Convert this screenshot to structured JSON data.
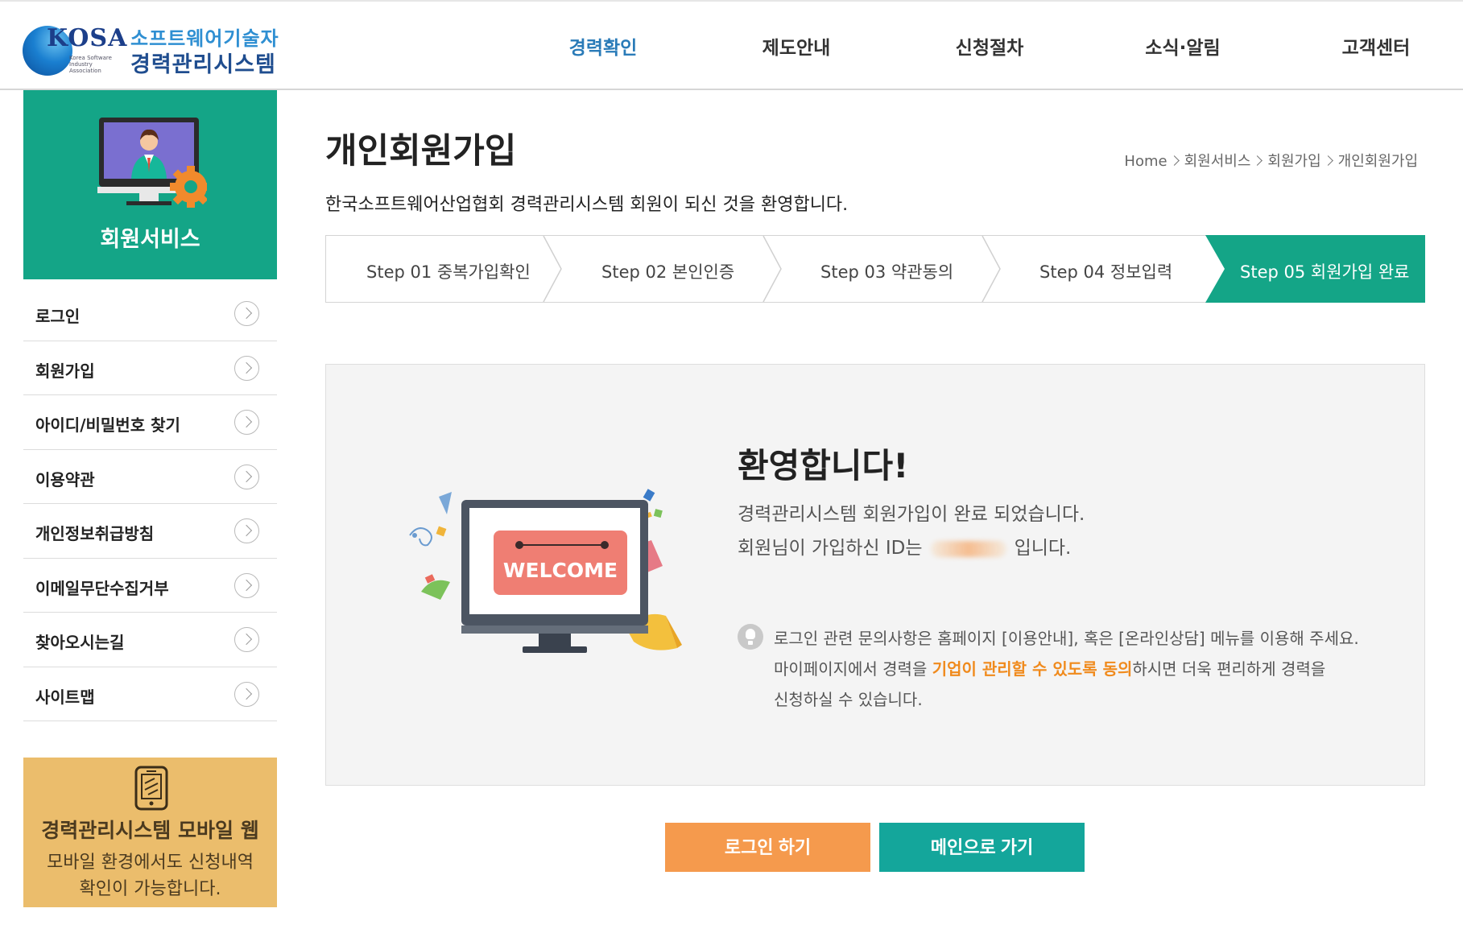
{
  "colors": {
    "green": "#14a587",
    "accent_orange": "#f08a1c",
    "login_button": "#f59a4d",
    "main_button": "#14a69b",
    "mobile_banner": "#ebbd6c",
    "nav_active": "#2a7bb8"
  },
  "logo": {
    "abbr": "KOSA",
    "org_small": "Korea Software Industry Association",
    "line1": "소프트웨어기술자",
    "line2": "경력관리시스템"
  },
  "nav": {
    "items": [
      {
        "label": "경력확인",
        "active": true
      },
      {
        "label": "제도안내",
        "active": false
      },
      {
        "label": "신청절차",
        "active": false
      },
      {
        "label": "소식·알림",
        "active": false
      },
      {
        "label": "고객센터",
        "active": false
      }
    ]
  },
  "sidebar": {
    "title": "회원서비스",
    "icon": "monitor-person-gear-icon",
    "items": [
      {
        "label": "로그인"
      },
      {
        "label": "회원가입"
      },
      {
        "label": "아이디/비밀번호 찾기"
      },
      {
        "label": "이용약관"
      },
      {
        "label": "개인정보취급방침"
      },
      {
        "label": "이메일무단수집거부"
      },
      {
        "label": "찾아오시는길"
      },
      {
        "label": "사이트맵"
      }
    ]
  },
  "mobile_banner": {
    "icon": "tablet-icon",
    "title": "경력관리시스템 모바일 웹",
    "desc_line1": "모바일 환경에서도 신청내역",
    "desc_line2": "확인이 가능합니다."
  },
  "page": {
    "title": "개인회원가입",
    "desc": "한국소프트웨어산업협회 경력관리시스템 회원이 되신 것을 환영합니다.",
    "breadcrumb": [
      "Home",
      "회원서비스",
      "회원가입",
      "개인회원가입"
    ]
  },
  "steps": [
    {
      "label": "Step 01 중복가입확인"
    },
    {
      "label": "Step 02 본인인증"
    },
    {
      "label": "Step 03 약관동의"
    },
    {
      "label": "Step 04 정보입력"
    },
    {
      "label": "Step 05 회원가입 완료",
      "active": true
    }
  ],
  "welcome": {
    "illustration_text": "WELCOME",
    "title": "환영합니다!",
    "line1": "경력관리시스템 회원가입이 완료 되었습니다.",
    "line2_prefix": "회원님이 가입하신 ID는",
    "line2_suffix": "입니다.",
    "info_line1": "로그인 관련 문의사항은 홈페이지 [이용안내], 혹은 [온라인상담] 메뉴를 이용해 주세요.",
    "info_line2_prefix": "마이페이지에서 경력을 ",
    "info_line2_highlight": "기업이 관리할 수 있도록 동의",
    "info_line2_suffix": "하시면 더욱 편리하게 경력을",
    "info_line3": "신청하실 수 있습니다."
  },
  "buttons": {
    "login": "로그인 하기",
    "main": "메인으로 가기"
  }
}
